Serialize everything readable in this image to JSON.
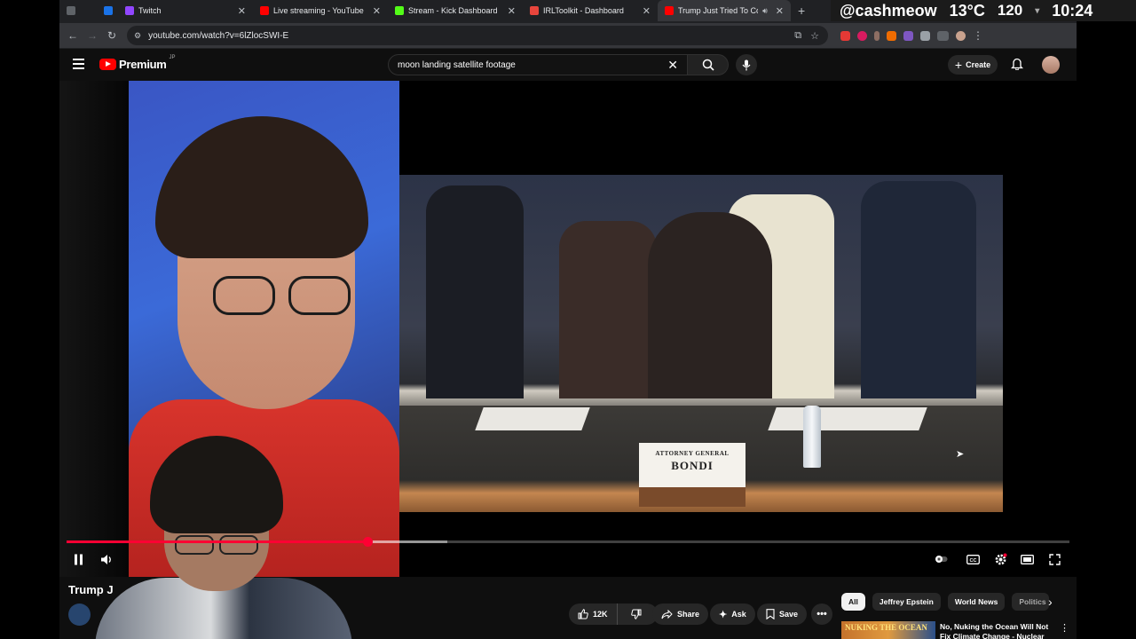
{
  "overlay": {
    "handle": "@cashmeow",
    "temperature": "13°C",
    "counter": "120",
    "time": "10:24"
  },
  "browser": {
    "tabs": [
      {
        "title": "",
        "icon": "window-icon",
        "active": false,
        "color": "#5f6368"
      },
      {
        "title": "",
        "icon": "app-icon",
        "active": false,
        "color": "#1a73e8"
      },
      {
        "title": "Twitch",
        "icon": "twitch-icon",
        "active": false,
        "color": "#9146ff"
      },
      {
        "title": "Live streaming - YouTube Stu",
        "icon": "youtube-icon",
        "active": false,
        "color": "#ff0000"
      },
      {
        "title": "Stream - Kick Dashboard",
        "icon": "kick-icon",
        "active": false,
        "color": "#53fc18"
      },
      {
        "title": "IRLToolkit - Dashboard",
        "icon": "irltoolkit-icon",
        "active": false,
        "color": "#e8453c"
      },
      {
        "title": "Trump Just Tried To Cov",
        "icon": "youtube-icon",
        "active": true,
        "color": "#ff0000"
      }
    ],
    "url": "youtube.com/watch?v=6lZlocSWI-E"
  },
  "youtube": {
    "logo_text": "Premium",
    "logo_region": "JP",
    "search_query": "moon landing satellite footage",
    "create_label": "Create",
    "player": {
      "progress_fraction": 0.3,
      "buffer_fraction": 0.38,
      "nameplate_line1": "ATTORNEY GENERAL",
      "nameplate_line2": "BONDI"
    },
    "video_title": "Trump J",
    "like_count": "12K",
    "share_label": "Share",
    "ask_label": "Ask",
    "save_label": "Save",
    "chips": [
      "All",
      "Jeffrey Epstein",
      "World News",
      "Politics"
    ],
    "recommendation": {
      "thumb_text": "NUKING THE OCEAN",
      "title": "No, Nuking the Ocean Will Not Fix Climate Change - Nuclear"
    }
  },
  "colors": {
    "accent": "#ff0033",
    "youtube_red": "#ff0000",
    "background": "#0f0f0f"
  }
}
